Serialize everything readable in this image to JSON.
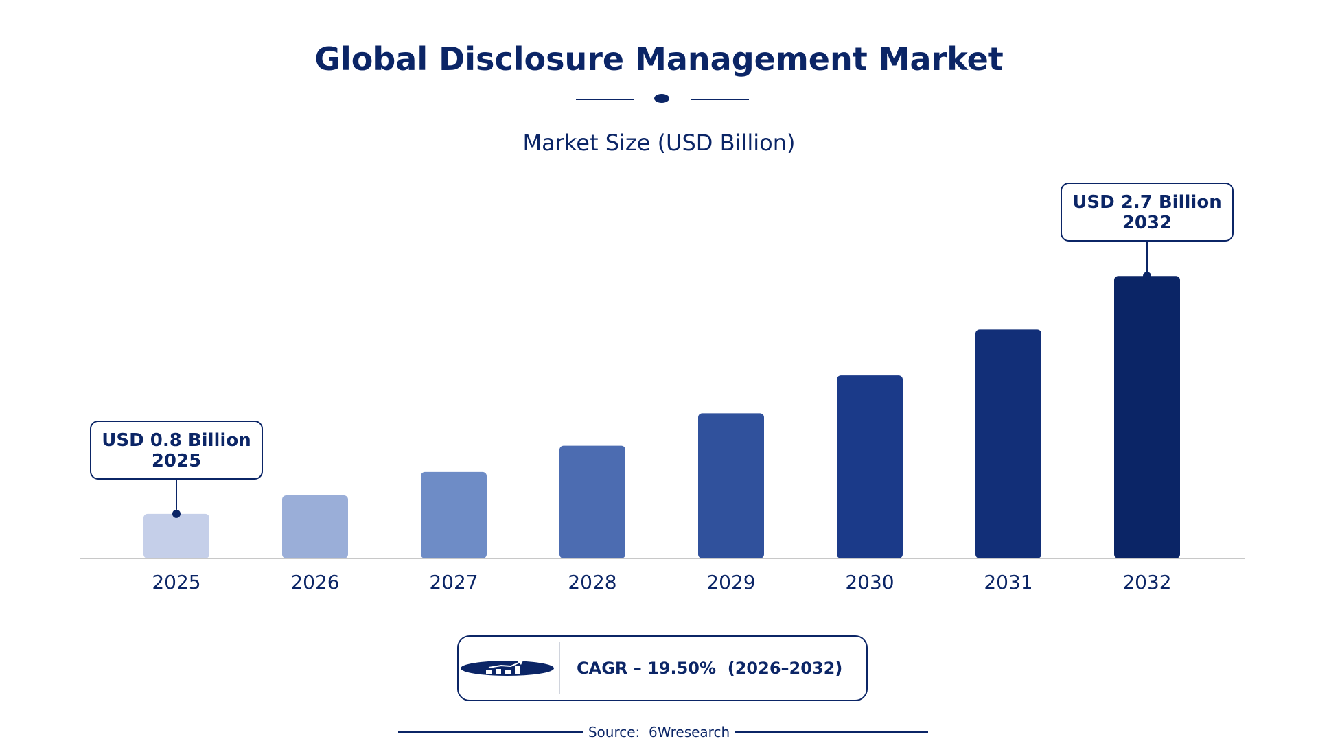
{
  "header": {
    "title": "Global Disclosure Management Market",
    "subtitle": "Market Size (USD Billion)"
  },
  "chart_data": {
    "type": "bar",
    "title": "Global Disclosure Management Market",
    "subtitle": "Market Size (USD Billion)",
    "xlabel": "",
    "ylabel": "",
    "categories": [
      "2025",
      "2026",
      "2027",
      "2028",
      "2029",
      "2030",
      "2031",
      "2032"
    ],
    "values": [
      0.8,
      1.13,
      1.55,
      2.02,
      2.6,
      3.28,
      4.1,
      5.06
    ],
    "ylim": [
      0,
      5.8
    ],
    "grid": false,
    "colors": [
      "#c5cfe9",
      "#9aaed8",
      "#6e8cc6",
      "#4c6cb1",
      "#30519c",
      "#1b3a89",
      "#122f78",
      "#0b2566"
    ],
    "annotations": [
      {
        "category": "2025",
        "label": "USD 0.8 Billion",
        "year": "2025"
      },
      {
        "category": "2032",
        "label": "USD 2.7 Billion",
        "year": "2032"
      }
    ]
  },
  "cagr": {
    "text": "CAGR – 19.50%  (2026–2032)",
    "icon": "growth-chart-icon"
  },
  "footer": {
    "source": "Source:  6Wresearch"
  },
  "colors": {
    "primary": "#0b2566",
    "axis": "#c8c8c8"
  }
}
